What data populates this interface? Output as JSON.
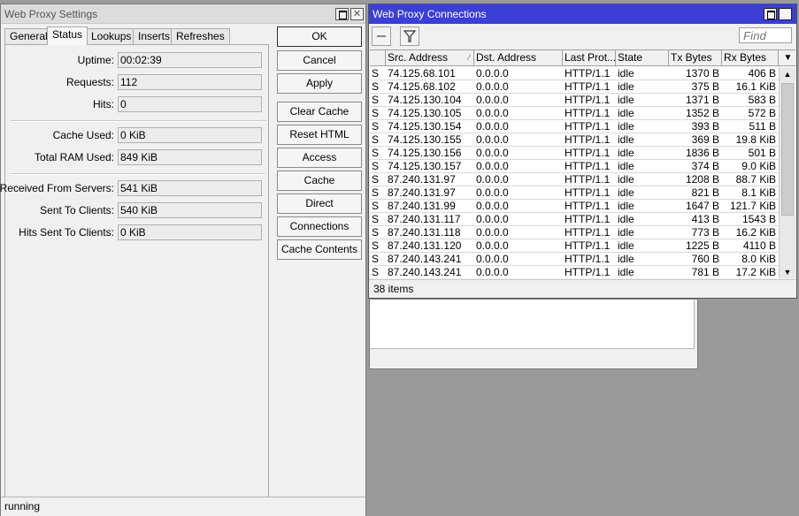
{
  "settings": {
    "title": "Web Proxy Settings",
    "tabs": [
      "General",
      "Status",
      "Lookups",
      "Inserts",
      "Refreshes"
    ],
    "fields": [
      {
        "label": "Uptime:",
        "value": "00:02:39"
      },
      {
        "label": "Requests:",
        "value": "112"
      },
      {
        "label": "Hits:",
        "value": "0"
      },
      {
        "label": "Cache Used:",
        "value": "0 KiB"
      },
      {
        "label": "Total RAM Used:",
        "value": "849 KiB"
      },
      {
        "label": "Received From Servers:",
        "value": "541 KiB"
      },
      {
        "label": "Sent To Clients:",
        "value": "540 KiB"
      },
      {
        "label": "Hits Sent To Clients:",
        "value": "0 KiB"
      }
    ],
    "buttons": [
      "OK",
      "Cancel",
      "Apply",
      "Clear Cache",
      "Reset HTML",
      "Access",
      "Cache",
      "Direct",
      "Connections",
      "Cache Contents"
    ],
    "status": "running"
  },
  "connections": {
    "title": "Web Proxy Connections",
    "find_placeholder": "Find",
    "columns": [
      "",
      "Src. Address",
      "Dst. Address",
      "Last Prot...",
      "State",
      "Tx Bytes",
      "Rx Bytes"
    ],
    "rows": [
      [
        "S",
        "74.125.68.101",
        "0.0.0.0",
        "HTTP/1.1",
        "idle",
        "1370 B",
        "406 B"
      ],
      [
        "S",
        "74.125.68.102",
        "0.0.0.0",
        "HTTP/1.1",
        "idle",
        "375 B",
        "16.1 KiB"
      ],
      [
        "S",
        "74.125.130.104",
        "0.0.0.0",
        "HTTP/1.1",
        "idle",
        "1371 B",
        "583 B"
      ],
      [
        "S",
        "74.125.130.105",
        "0.0.0.0",
        "HTTP/1.1",
        "idle",
        "1352 B",
        "572 B"
      ],
      [
        "S",
        "74.125.130.154",
        "0.0.0.0",
        "HTTP/1.1",
        "idle",
        "393 B",
        "511 B"
      ],
      [
        "S",
        "74.125.130.155",
        "0.0.0.0",
        "HTTP/1.1",
        "idle",
        "369 B",
        "19.8 KiB"
      ],
      [
        "S",
        "74.125.130.156",
        "0.0.0.0",
        "HTTP/1.1",
        "idle",
        "1836 B",
        "501 B"
      ],
      [
        "S",
        "74.125.130.157",
        "0.0.0.0",
        "HTTP/1.1",
        "idle",
        "374 B",
        "9.0 KiB"
      ],
      [
        "S",
        "87.240.131.97",
        "0.0.0.0",
        "HTTP/1.1",
        "idle",
        "1208 B",
        "88.7 KiB"
      ],
      [
        "S",
        "87.240.131.97",
        "0.0.0.0",
        "HTTP/1.1",
        "idle",
        "821 B",
        "8.1 KiB"
      ],
      [
        "S",
        "87.240.131.99",
        "0.0.0.0",
        "HTTP/1.1",
        "idle",
        "1647 B",
        "121.7 KiB"
      ],
      [
        "S",
        "87.240.131.117",
        "0.0.0.0",
        "HTTP/1.1",
        "idle",
        "413 B",
        "1543 B"
      ],
      [
        "S",
        "87.240.131.118",
        "0.0.0.0",
        "HTTP/1.1",
        "idle",
        "773 B",
        "16.2 KiB"
      ],
      [
        "S",
        "87.240.131.120",
        "0.0.0.0",
        "HTTP/1.1",
        "idle",
        "1225 B",
        "4110 B"
      ],
      [
        "S",
        "87.240.143.241",
        "0.0.0.0",
        "HTTP/1.1",
        "idle",
        "760 B",
        "8.0 KiB"
      ],
      [
        "S",
        "87.240.143.241",
        "0.0.0.0",
        "HTTP/1.1",
        "idle",
        "781 B",
        "17.2 KiB"
      ]
    ],
    "item_count": "38 items"
  }
}
